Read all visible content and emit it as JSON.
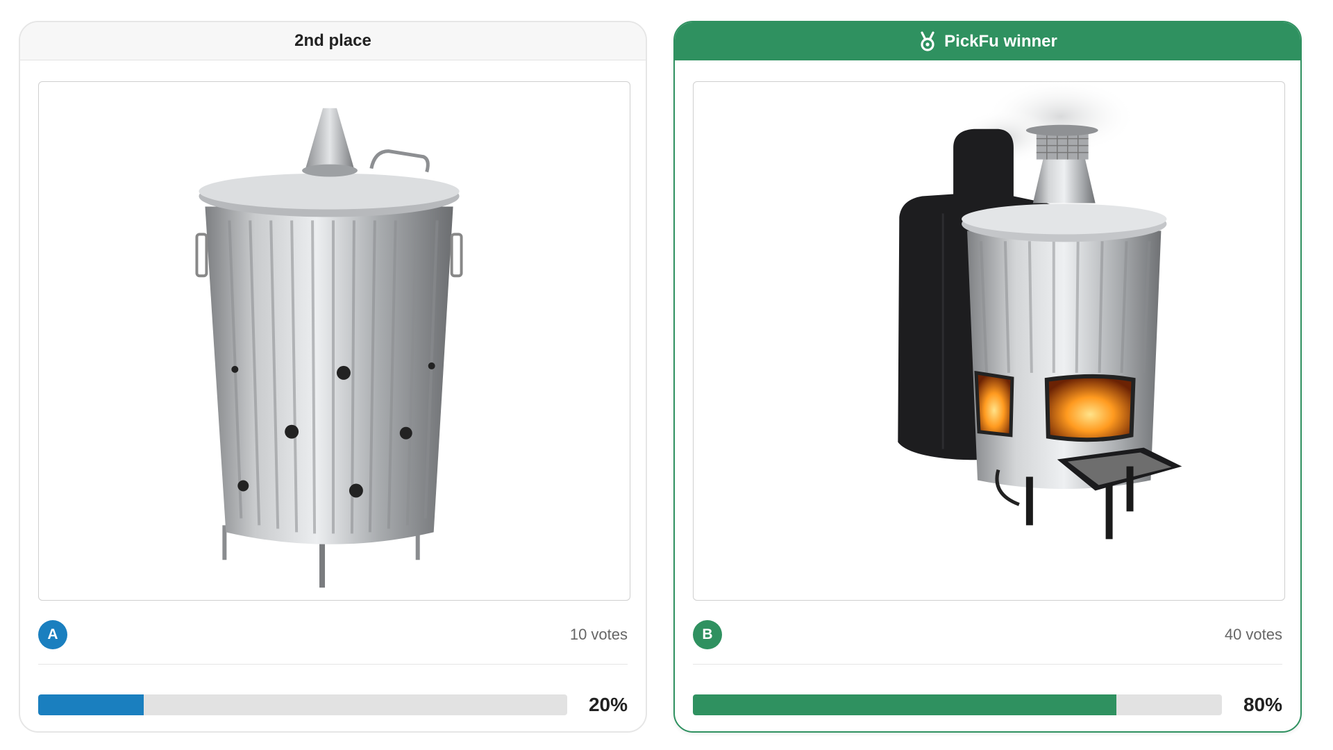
{
  "options": [
    {
      "header": "2nd place",
      "letter": "A",
      "votes_text": "10 votes",
      "percent_text": "20%",
      "progress_fraction": 0.2,
      "bar_color": "#1a7fbf",
      "image_icon": "galvanized-incinerator-bin-image"
    },
    {
      "header": "PickFu winner",
      "header_icon": "medal-icon",
      "letter": "B",
      "votes_text": "40 votes",
      "percent_text": "80%",
      "progress_fraction": 0.8,
      "bar_color": "#2f9160",
      "image_icon": "incinerator-stove-with-cover-image"
    }
  ]
}
